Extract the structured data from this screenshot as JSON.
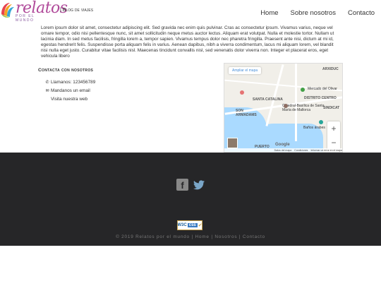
{
  "logo": {
    "word": "relatos",
    "sub": "POR EL MUNDO"
  },
  "header": {
    "tagline": "| Blog de viajes"
  },
  "nav": [
    {
      "label": "Home"
    },
    {
      "label": "Sobre nosotros"
    },
    {
      "label": "Contacto"
    }
  ],
  "intro": "Lorem ipsum dolor sit amet, consectetur adipiscing elit. Sed gravida nec enim quis pulvinar. Cras ac consectetur ipsum. Vivamus varius, neque vel ornare tempor, odio nisi pellentesque nunc, sit amet sollicitudin neque metus auctor lectus. Aliquam erat volutpat. Nulla et molestie tortor. Nullam ut lacinia diam. In sed metus facilisis, fringilla lorem a, tempor sapien. Vivamus tempus dolor nec pharetra fringilla. Praesent ante nisi, dictum at mi id, egestas hendrerit felis. Suspendisse porta aliquam felis in varius. Aenean dapibus, nibh a viverra condimentum, lacus mi aliquam lorem, vel blandit nisi nulla eget justo. Curabitur vitae facilisis nisl. Maecenas tincidunt convallis nisl, sed venenatis dolor viverra non. Integer et placerat eros, eget vehicula libero",
  "contact": {
    "title": "Contacta con nosotros",
    "phone": "Llamanos: 123456789",
    "email": "Mandanos un email",
    "visit": "Visita nuestra web"
  },
  "map": {
    "enlarge": "Ampliar el mapa",
    "labels": {
      "arxiduc": "ARXIDUC",
      "santa_catalina": "SANTA CATALINA",
      "mercado": "Mercado del Olivar",
      "distrito": "DISTRITO CENTRO",
      "catedral": "Catedral-Basílica de Santa María de Mallorca",
      "son_armadams": "SON ARMADAMS",
      "sindicat": "SINDICAT",
      "banos": "Baños árabes",
      "puerto": "PUERTO",
      "google": "Google"
    },
    "zoom_in": "+",
    "zoom_out": "−",
    "footer": [
      "Datos del mapa",
      "Condiciones",
      "Informar un error en el mapa"
    ]
  },
  "footer": {
    "badge_w3c": "W3C",
    "badge_css": "css",
    "copyright": "© 2019 Relatos por el mundo | Home | Nosotros | Contacto"
  }
}
